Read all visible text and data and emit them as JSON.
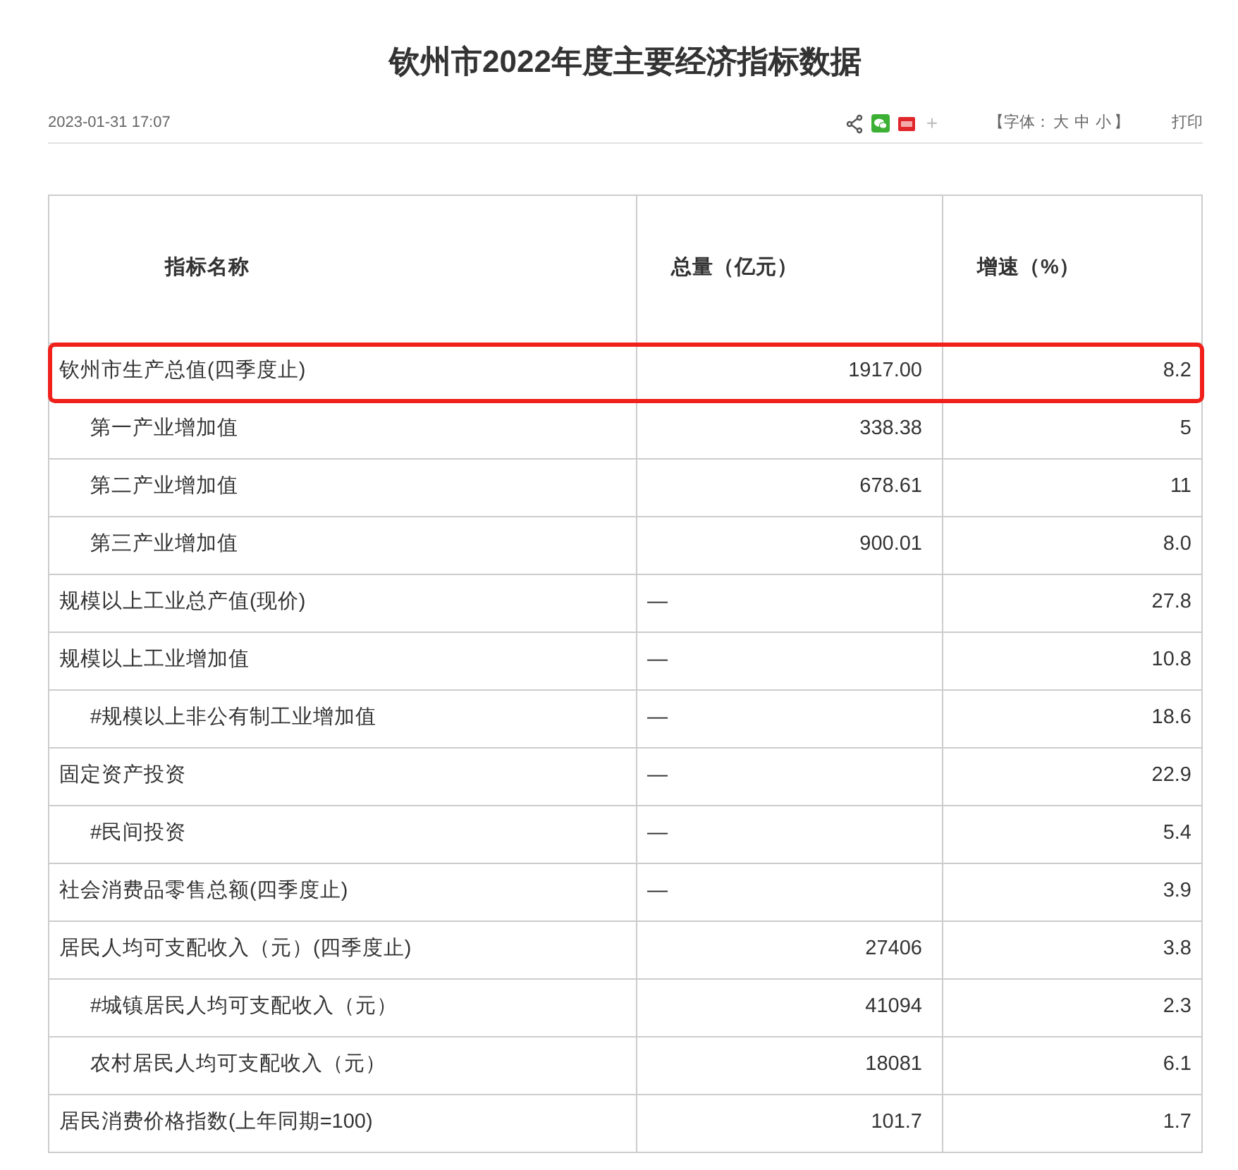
{
  "article": {
    "title": "钦州市2022年度主要经济指标数据",
    "date": "2023-01-31 17:07",
    "share_more": "+",
    "font_size": {
      "prefix": "【字体：",
      "options": [
        "大",
        "中",
        "小"
      ],
      "suffix": "】"
    },
    "print": "打印"
  },
  "table": {
    "columns": [
      "指标名称",
      "总量（亿元）",
      "增速（%）"
    ],
    "rows": [
      {
        "name": "钦州市生产总值(四季度止)",
        "total": "1917.00",
        "kind": "number",
        "growth": "8.2",
        "highlighted": true,
        "children": [
          {
            "name": "第一产业增加值",
            "total": "338.38",
            "kind": "number",
            "growth": "5",
            "highlighted": false
          },
          {
            "name": "第二产业增加值",
            "total": "678.61",
            "kind": "number",
            "growth": "11",
            "highlighted": false
          },
          {
            "name": "第三产业增加值",
            "total": "900.01",
            "kind": "number",
            "growth": "8.0",
            "highlighted": false
          }
        ]
      },
      {
        "name": "规模以上工业总产值(现价)",
        "total": "—",
        "kind": "dash",
        "growth": "27.8",
        "highlighted": false
      },
      {
        "name": "规模以上工业增加值",
        "total": "—",
        "kind": "dash",
        "growth": "10.8",
        "highlighted": false,
        "children": [
          {
            "name": "#规模以上非公有制工业增加值",
            "total": "—",
            "kind": "dash",
            "growth": "18.6",
            "highlighted": false
          }
        ]
      },
      {
        "name": "固定资产投资",
        "total": "—",
        "kind": "dash",
        "growth": "22.9",
        "highlighted": false,
        "children": [
          {
            "name": "#民间投资",
            "total": "—",
            "kind": "dash",
            "growth": "5.4",
            "highlighted": false
          }
        ]
      },
      {
        "name": "社会消费品零售总额(四季度止)",
        "total": "—",
        "kind": "dash",
        "growth": "3.9",
        "highlighted": false
      },
      {
        "name": "居民人均可支配收入（元）(四季度止)",
        "total": "27406",
        "kind": "number",
        "growth": "3.8",
        "highlighted": false,
        "children": [
          {
            "name": "#城镇居民人均可支配收入（元）",
            "total": "41094",
            "kind": "number",
            "growth": "2.3",
            "highlighted": false
          },
          {
            "name": "农村居民人均可支配收入（元）",
            "total": "18081",
            "kind": "number",
            "growth": "6.1",
            "highlighted": false
          }
        ]
      },
      {
        "name": "居民消费价格指数(上年同期=100)",
        "total": "101.7",
        "kind": "number",
        "growth": "1.7",
        "highlighted": false
      }
    ]
  }
}
